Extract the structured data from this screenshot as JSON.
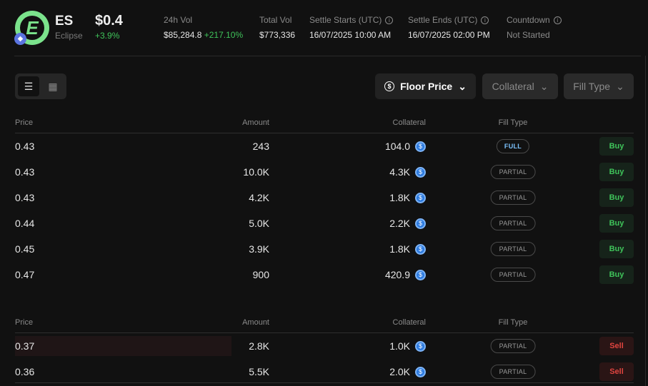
{
  "token": {
    "symbol": "ES",
    "name": "Eclipse",
    "logo_letter": "E",
    "chain_icon": "ethereum-icon",
    "price": "$0.4",
    "change": "+3.9%"
  },
  "stats": [
    {
      "label": "24h Vol",
      "value": "$85,284.8",
      "extra": "+217.10%",
      "info": false
    },
    {
      "label": "Total Vol",
      "value": "$773,336",
      "info": false
    },
    {
      "label": "Settle Starts (UTC)",
      "value": "16/07/2025 10:00 AM",
      "info": true
    },
    {
      "label": "Settle Ends (UTC)",
      "value": "16/07/2025 02:00 PM",
      "info": true
    },
    {
      "label": "Countdown",
      "value": "Not Started",
      "info": true
    }
  ],
  "filters": {
    "floor_price": "Floor Price",
    "collateral": "Collateral",
    "fill_type": "Fill Type"
  },
  "headers": {
    "price": "Price",
    "amount": "Amount",
    "collateral": "Collateral",
    "fill_type": "Fill Type"
  },
  "buy_orders": [
    {
      "price": "0.43",
      "amount": "243",
      "collateral": "104.0",
      "fill": "FULL",
      "action": "Buy"
    },
    {
      "price": "0.43",
      "amount": "10.0K",
      "collateral": "4.3K",
      "fill": "PARTIAL",
      "action": "Buy"
    },
    {
      "price": "0.43",
      "amount": "4.2K",
      "collateral": "1.8K",
      "fill": "PARTIAL",
      "action": "Buy"
    },
    {
      "price": "0.44",
      "amount": "5.0K",
      "collateral": "2.2K",
      "fill": "PARTIAL",
      "action": "Buy"
    },
    {
      "price": "0.45",
      "amount": "3.9K",
      "collateral": "1.8K",
      "fill": "PARTIAL",
      "action": "Buy"
    },
    {
      "price": "0.47",
      "amount": "900",
      "collateral": "420.9",
      "fill": "PARTIAL",
      "action": "Buy"
    }
  ],
  "sell_orders": [
    {
      "price": "0.37",
      "amount": "2.8K",
      "collateral": "1.0K",
      "fill": "PARTIAL",
      "action": "Sell",
      "depth": 0.35
    },
    {
      "price": "0.36",
      "amount": "5.5K",
      "collateral": "2.0K",
      "fill": "PARTIAL",
      "action": "Sell"
    }
  ]
}
